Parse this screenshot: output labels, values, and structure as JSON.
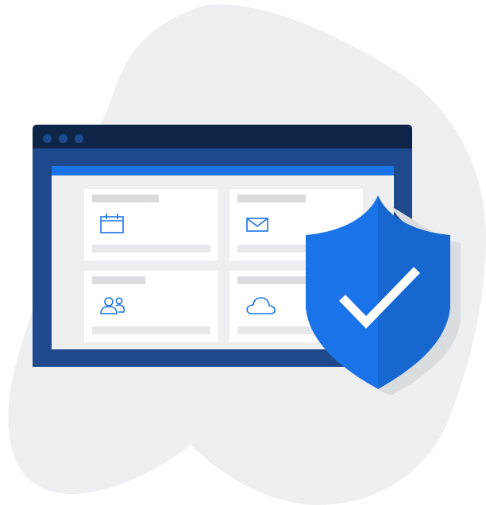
{
  "illustration": {
    "browser_window": {
      "window_controls": [
        "dot",
        "dot",
        "dot"
      ],
      "cards": [
        {
          "name": "calendar",
          "icon": "calendar-icon"
        },
        {
          "name": "mail",
          "icon": "mail-icon"
        },
        {
          "name": "contacts",
          "icon": "users-icon"
        },
        {
          "name": "cloud",
          "icon": "cloud-icon"
        }
      ]
    },
    "shield": {
      "icon": "shield-check-icon"
    }
  },
  "colors": {
    "blob": "#edeff0",
    "titlebar": "#0f2548",
    "frame": "#1e4a8d",
    "accent": "#1a73e8",
    "shield_light": "#1a73e8",
    "shield_dark": "#1767d1",
    "card_bar": "#dadcdd"
  }
}
